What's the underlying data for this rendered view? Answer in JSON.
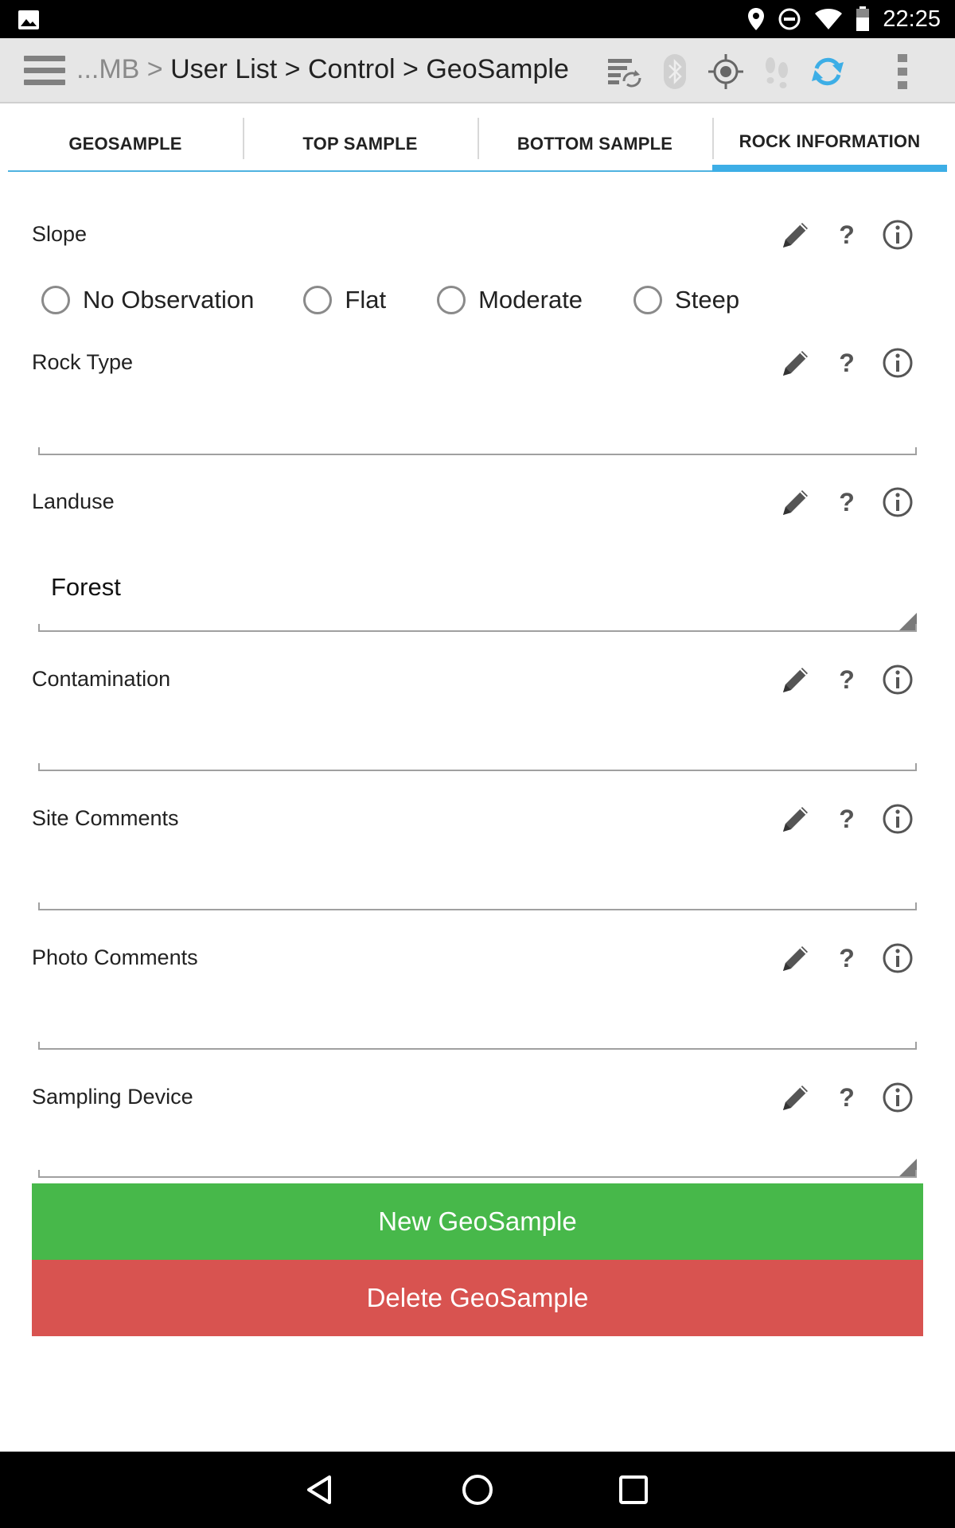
{
  "status_bar": {
    "time": "22:25",
    "icons": [
      "image-icon",
      "location-icon",
      "do-not-disturb-icon",
      "wifi-icon",
      "battery-icon"
    ]
  },
  "action_bar": {
    "breadcrumb_prefix": "...MB >",
    "breadcrumb_path": "User List > Control > GeoSample",
    "icons": [
      "sync-list-icon",
      "bluetooth-icon",
      "gps-target-icon",
      "footsteps-icon",
      "refresh-icon",
      "overflow-menu-icon"
    ],
    "accent_color": "#3daee6"
  },
  "tabs": [
    {
      "label": "GEOSAMPLE",
      "active": false
    },
    {
      "label": "TOP SAMPLE",
      "active": false
    },
    {
      "label": "BOTTOM SAMPLE",
      "active": false
    },
    {
      "label": "ROCK INFORMATION",
      "active": true
    }
  ],
  "form": {
    "slope": {
      "label": "Slope",
      "options": [
        "No Observation",
        "Flat",
        "Moderate",
        "Steep"
      ],
      "selected": null
    },
    "rock_type": {
      "label": "Rock Type",
      "value": ""
    },
    "landuse": {
      "label": "Landuse",
      "value": "Forest"
    },
    "contamination": {
      "label": "Contamination",
      "value": ""
    },
    "site_comments": {
      "label": "Site Comments",
      "value": ""
    },
    "photo_comments": {
      "label": "Photo Comments",
      "value": ""
    },
    "sampling_device": {
      "label": "Sampling Device",
      "value": ""
    },
    "help_glyph": "?"
  },
  "buttons": {
    "new": {
      "label": "New GeoSample",
      "color": "#47b84a"
    },
    "delete": {
      "label": "Delete GeoSample",
      "color": "#d85350"
    }
  },
  "nav_bar": {
    "icons": [
      "back-icon",
      "home-icon",
      "recents-icon"
    ]
  }
}
